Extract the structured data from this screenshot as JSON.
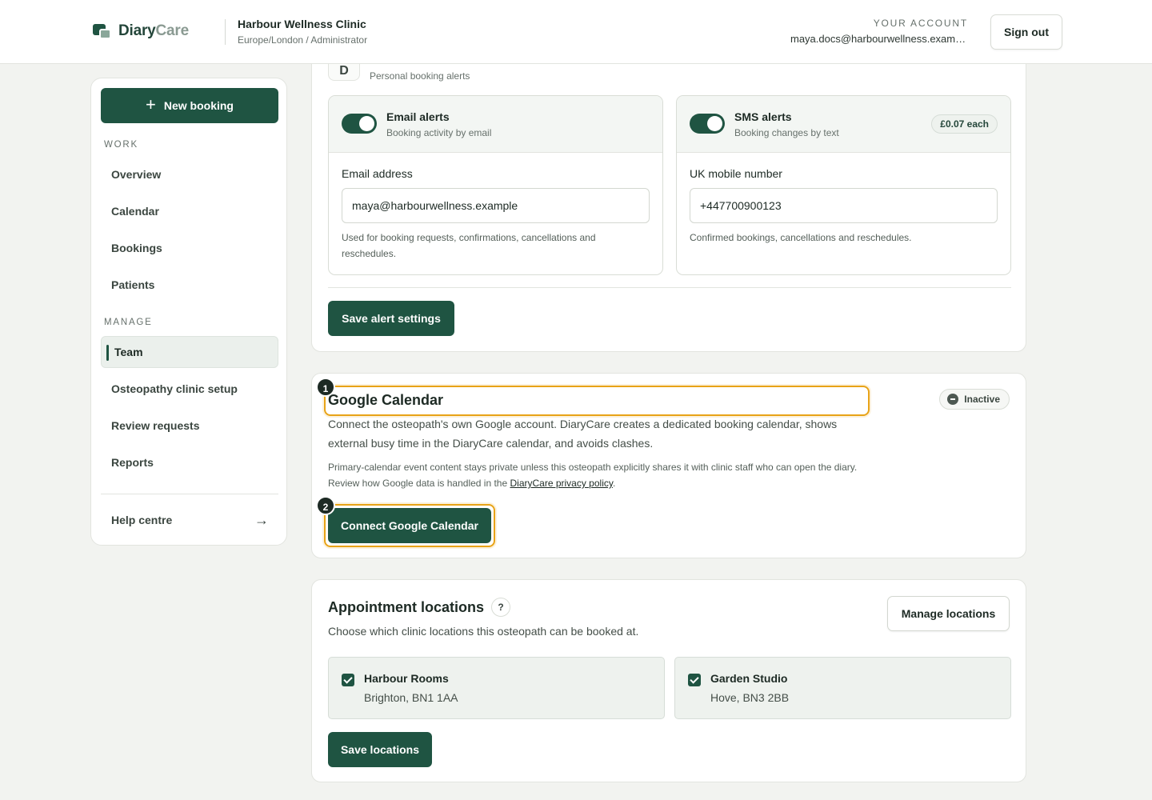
{
  "header": {
    "brand_primary": "Diary",
    "brand_secondary": "Care",
    "clinic_name": "Harbour Wellness Clinic",
    "clinic_sub": "Europe/London / Administrator",
    "account_label": "YOUR ACCOUNT",
    "account_email": "maya.docs@harbourwellness.example",
    "signout_label": "Sign out"
  },
  "sidebar": {
    "new_booking_label": "New booking",
    "work_label": "WORK",
    "work_items": [
      {
        "label": "Overview"
      },
      {
        "label": "Calendar"
      },
      {
        "label": "Bookings"
      },
      {
        "label": "Patients"
      }
    ],
    "manage_label": "MANAGE",
    "manage_items": [
      {
        "label": "Team",
        "active": true
      },
      {
        "label": "Osteopathy clinic setup"
      },
      {
        "label": "Review requests"
      },
      {
        "label": "Reports"
      }
    ],
    "help_label": "Help centre"
  },
  "alerts": {
    "icon_letter": "D",
    "subtitle": "Personal booking alerts",
    "email": {
      "title": "Email alerts",
      "desc": "Booking activity by email",
      "enabled": true,
      "field_label": "Email address",
      "value": "maya@harbourwellness.example",
      "help": "Used for booking requests, confirmations, cancellations and reschedules."
    },
    "sms": {
      "title": "SMS alerts",
      "desc": "Booking changes by text",
      "enabled": true,
      "price": "£0.07 each",
      "field_label": "UK mobile number",
      "value": "+447700900123",
      "help": "Confirmed bookings, cancellations and reschedules."
    },
    "save_label": "Save alert settings"
  },
  "google_calendar": {
    "marker1": "1",
    "marker2": "2",
    "title": "Google Calendar",
    "status": "Inactive",
    "description": "Connect the osteopath's own Google account. DiaryCare creates a dedicated booking calendar, shows external busy time in the DiaryCare calendar, and avoids clashes.",
    "note_prefix": "Primary-calendar event content stays private unless this osteopath explicitly shares it with clinic staff who can open the diary. Review how Google data is handled in the ",
    "note_link": "DiaryCare privacy policy",
    "note_suffix": ".",
    "connect_label": "Connect Google Calendar"
  },
  "locations": {
    "title": "Appointment locations",
    "help_icon": "?",
    "subtitle": "Choose which clinic locations this osteopath can be booked at.",
    "manage_label": "Manage locations",
    "items": [
      {
        "name": "Harbour Rooms",
        "address": "Brighton, BN1 1AA",
        "checked": true
      },
      {
        "name": "Garden Studio",
        "address": "Hove, BN3 2BB",
        "checked": true
      }
    ],
    "save_label": "Save locations"
  },
  "colors": {
    "primary": "#1f5442",
    "highlight": "#e8a317",
    "background": "#f2f3f0"
  },
  "icons": [
    "plus-icon",
    "arrow-right-icon",
    "minus-circle-icon",
    "question-icon",
    "checkbox-checked-icon",
    "toggle-on-icon"
  ]
}
